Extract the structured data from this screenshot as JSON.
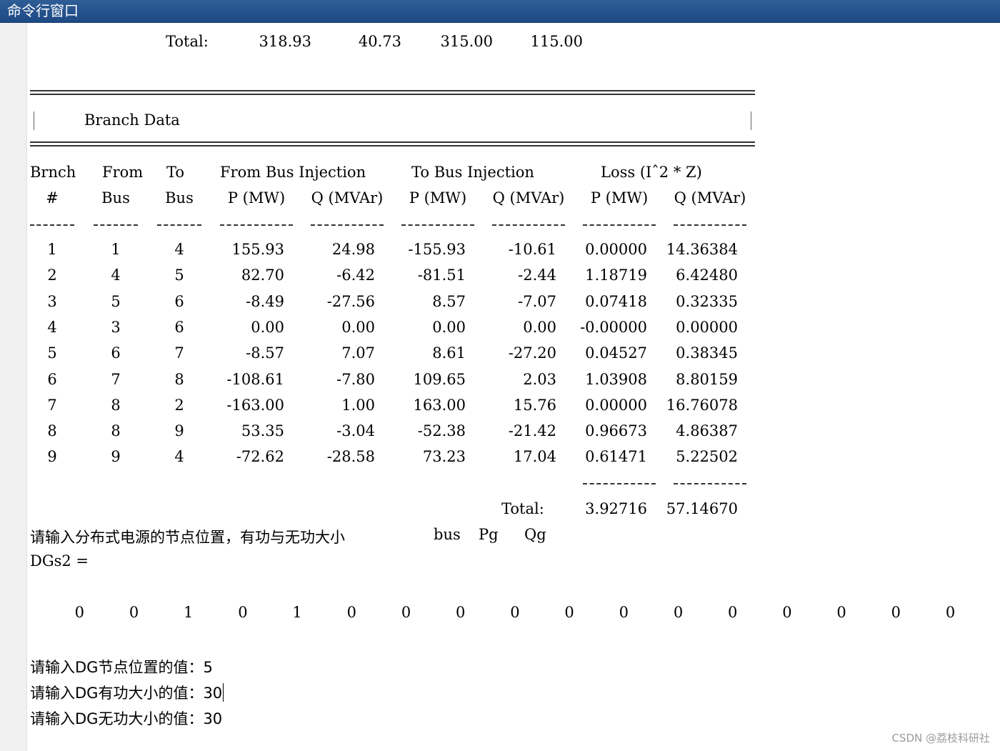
{
  "window": {
    "title": "命令行窗口"
  },
  "bus_totals": {
    "label": "Total:",
    "values": [
      "318.93",
      "40.73",
      "315.00",
      "115.00"
    ]
  },
  "branch_section": {
    "title": "Branch Data",
    "header1": [
      "Brnch",
      "From",
      "To",
      "From Bus Injection",
      "To Bus Injection",
      "Loss (Iˆ2 * Z)"
    ],
    "header2": [
      "#",
      "Bus",
      "Bus",
      "P (MW)",
      "Q (MVAr)",
      "P (MW)",
      "Q (MVAr)",
      "P (MW)",
      "Q (MVAr)"
    ],
    "columns": [
      "Brnch #",
      "From Bus",
      "To Bus",
      "From P (MW)",
      "From Q (MVAr)",
      "To P (MW)",
      "To Q (MVAr)",
      "Loss P (MW)",
      "Loss Q (MVAr)"
    ],
    "rows": [
      [
        "1",
        "1",
        "4",
        "155.93",
        "24.98",
        "-155.93",
        "-10.61",
        "0.00000",
        "14.36384"
      ],
      [
        "2",
        "4",
        "5",
        "82.70",
        "-6.42",
        "-81.51",
        "-2.44",
        "1.18719",
        "6.42480"
      ],
      [
        "3",
        "5",
        "6",
        "-8.49",
        "-27.56",
        "8.57",
        "-7.07",
        "0.07418",
        "0.32335"
      ],
      [
        "4",
        "3",
        "6",
        "0.00",
        "0.00",
        "0.00",
        "0.00",
        "-0.00000",
        "0.00000"
      ],
      [
        "5",
        "6",
        "7",
        "-8.57",
        "7.07",
        "8.61",
        "-27.20",
        "0.04527",
        "0.38345"
      ],
      [
        "6",
        "7",
        "8",
        "-108.61",
        "-7.80",
        "109.65",
        "2.03",
        "1.03908",
        "8.80159"
      ],
      [
        "7",
        "8",
        "2",
        "-163.00",
        "1.00",
        "163.00",
        "15.76",
        "0.00000",
        "16.76078"
      ],
      [
        "8",
        "8",
        "9",
        "53.35",
        "-3.04",
        "-52.38",
        "-21.42",
        "0.96673",
        "4.86387"
      ],
      [
        "9",
        "9",
        "4",
        "-72.62",
        "-28.58",
        "73.23",
        "17.04",
        "0.61471",
        "5.22502"
      ]
    ],
    "total_label": "Total:",
    "total_p": "3.92716",
    "total_q": "57.14670"
  },
  "prompts": {
    "dg_prompt": "请输入分布式电源的节点位置，有功与无功大小",
    "dg_columns": [
      "bus",
      "Pg",
      "Qg"
    ],
    "var_name": "DGs2 =",
    "vector": [
      "0",
      "0",
      "1",
      "0",
      "1",
      "0",
      "0",
      "0",
      "0",
      "0",
      "0",
      "0",
      "0",
      "0",
      "0",
      "0",
      "0"
    ],
    "input_bus": "请输入DG节点位置的值：5",
    "input_p": "请输入DG有功大小的值：30",
    "input_q": "请输入DG无功大小的值：30"
  },
  "watermark": "CSDN @荔枝科研社"
}
